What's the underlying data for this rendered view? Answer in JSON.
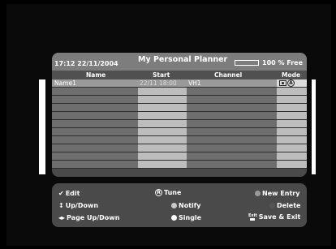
{
  "header": {
    "clock": "17:12 22/11/2004",
    "title": "My Personal Planner",
    "free_label": "100 % Free",
    "free_fraction": 0.0
  },
  "columns": {
    "name": "Name",
    "start": "Start",
    "channel": "Channel",
    "mode": "Mode"
  },
  "rows": [
    {
      "name": "Name1",
      "start": "22/11  18:00",
      "channel": "VH1",
      "mode_icons": [
        "record-icon",
        "alarm-icon"
      ]
    },
    {
      "name": "",
      "start": "",
      "channel": "",
      "mode_icons": []
    },
    {
      "name": "",
      "start": "",
      "channel": "",
      "mode_icons": []
    },
    {
      "name": "",
      "start": "",
      "channel": "",
      "mode_icons": []
    },
    {
      "name": "",
      "start": "",
      "channel": "",
      "mode_icons": []
    },
    {
      "name": "",
      "start": "",
      "channel": "",
      "mode_icons": []
    },
    {
      "name": "",
      "start": "",
      "channel": "",
      "mode_icons": []
    },
    {
      "name": "",
      "start": "",
      "channel": "",
      "mode_icons": []
    },
    {
      "name": "",
      "start": "",
      "channel": "",
      "mode_icons": []
    },
    {
      "name": "",
      "start": "",
      "channel": "",
      "mode_icons": []
    },
    {
      "name": "",
      "start": "",
      "channel": "",
      "mode_icons": []
    }
  ],
  "legend": {
    "edit": "Edit",
    "tune": "Tune",
    "new_entry": "New Entry",
    "updown": "Up/Down",
    "notify": "Notify",
    "delete": "Delete",
    "page_updown": "Page Up/Down",
    "single": "Single",
    "save_exit": "Save & Exit",
    "r_key": "R",
    "exit_key": "Exit",
    "colors": {
      "new_entry": "#9a9a9a",
      "notify": "#c8c8c8",
      "delete": "#555555",
      "single": "#ffffff"
    }
  }
}
